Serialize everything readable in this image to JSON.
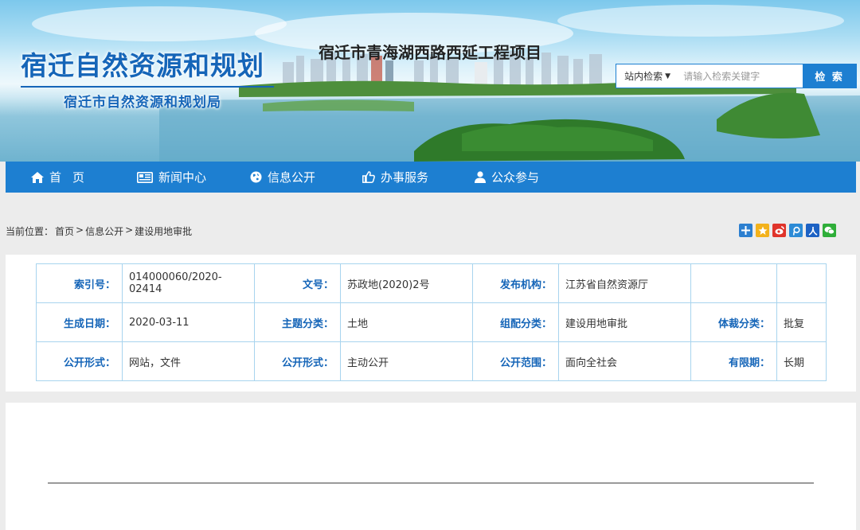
{
  "header": {
    "title": "宿迁自然资源和规划",
    "subtitle": "宿迁市自然资源和规划局"
  },
  "search": {
    "scope_label": "站内检索",
    "placeholder": "请输入检索关键字",
    "button_label": "检 索"
  },
  "nav": {
    "items": [
      {
        "label": "首页",
        "icon": "home-icon"
      },
      {
        "label": "新闻中心",
        "icon": "newspaper-icon"
      },
      {
        "label": "信息公开",
        "icon": "globe-icon"
      },
      {
        "label": "办事服务",
        "icon": "thumbs-up-icon"
      },
      {
        "label": "公众参与",
        "icon": "user-icon"
      }
    ]
  },
  "breadcrumb": {
    "prefix": "当前位置：",
    "items": [
      "首页",
      "信息公开",
      "建设用地审批"
    ],
    "separator": ">"
  },
  "share": {
    "icons": [
      "share-add-icon",
      "qzone-icon",
      "weibo-icon",
      "tencent-weibo-icon",
      "renren-icon",
      "wechat-icon"
    ]
  },
  "meta": {
    "rows": [
      [
        {
          "key": "索引号：",
          "value": "014000060/2020-02414"
        },
        {
          "key": "文号：",
          "value": "苏政地(2020)2号"
        },
        {
          "key": "发布机构：",
          "value": "江苏省自然资源厅"
        },
        {
          "key": "",
          "value": ""
        }
      ],
      [
        {
          "key": "生成日期：",
          "value": "2020-03-11"
        },
        {
          "key": "主题分类：",
          "value": "土地"
        },
        {
          "key": "组配分类：",
          "value": "建设用地审批"
        },
        {
          "key": "体裁分类：",
          "value": "批复"
        }
      ],
      [
        {
          "key": "公开形式：",
          "value": "网站，文件"
        },
        {
          "key": "公开形式：",
          "value": "主动公开"
        },
        {
          "key": "公开范围：",
          "value": "面向全社会"
        },
        {
          "key": "有限期：",
          "value": "长期"
        }
      ]
    ]
  },
  "article": {
    "title": "宿迁市青海湖西路西延工程项目"
  },
  "colors": {
    "brand_blue": "#1d7fd1",
    "title_blue": "#1565b8",
    "table_border": "#a8d4ee"
  }
}
